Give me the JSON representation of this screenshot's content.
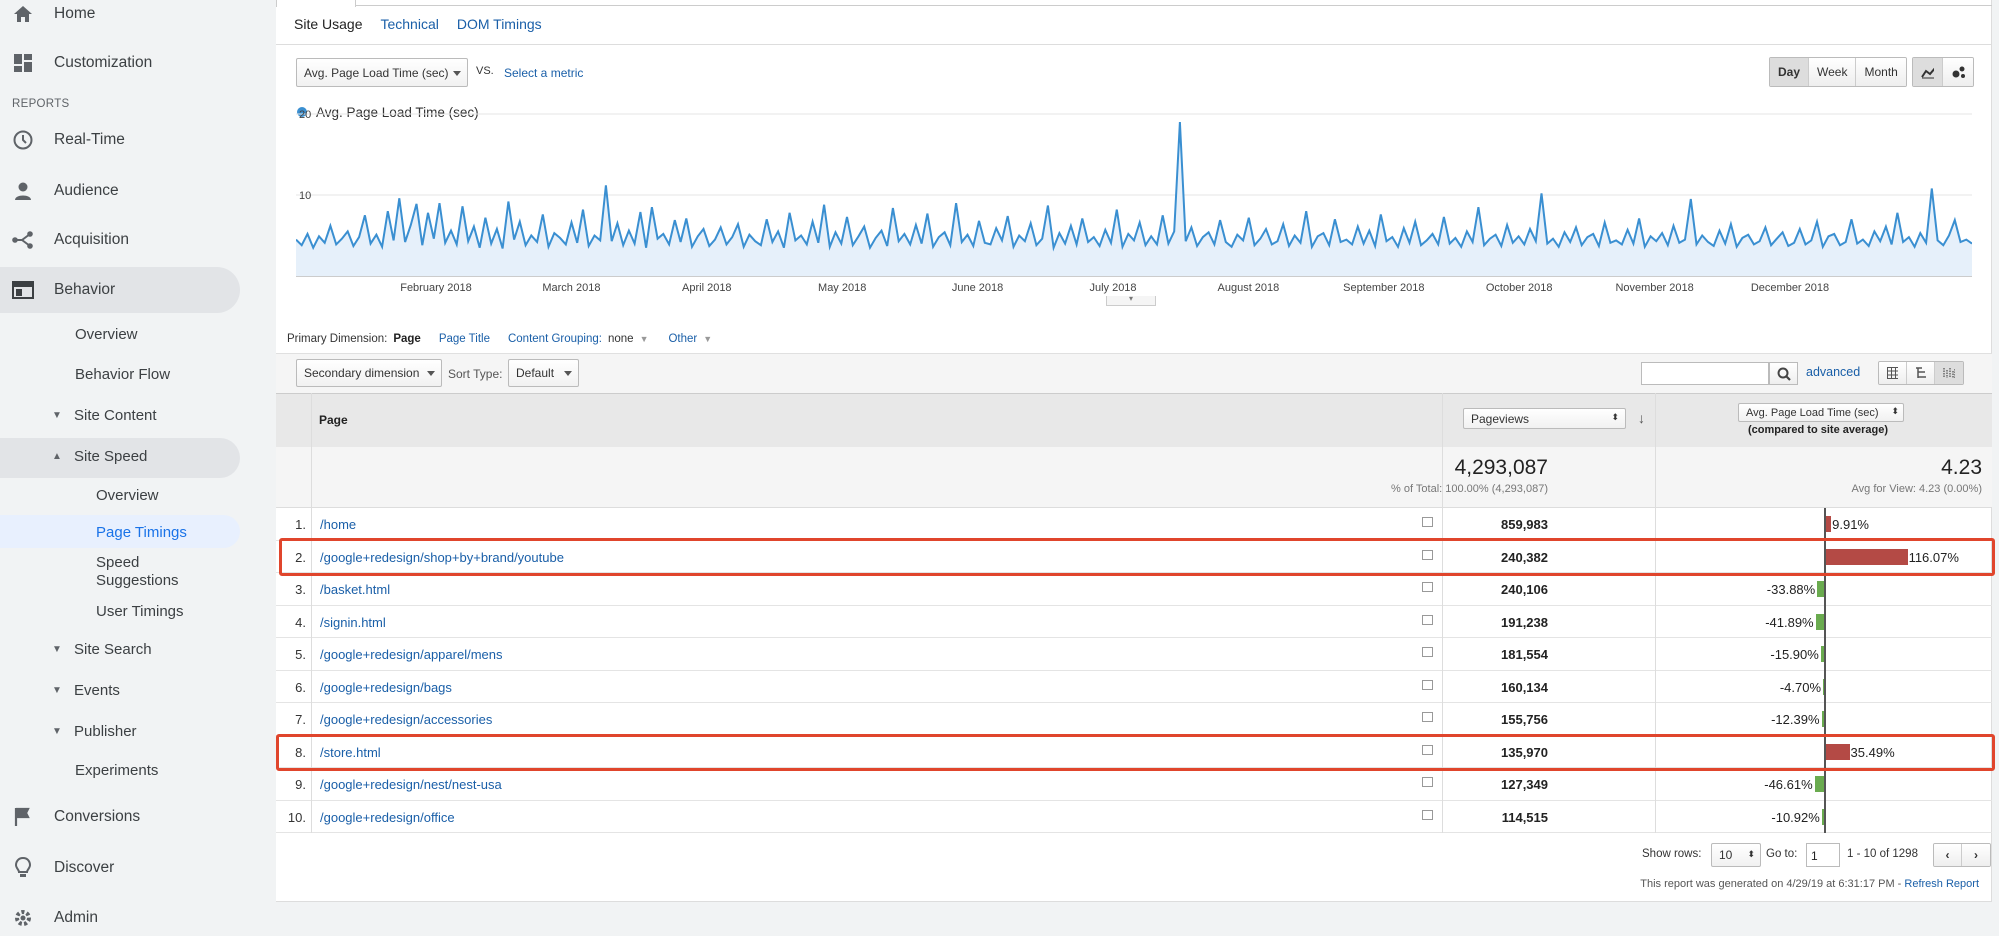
{
  "sidebar": {
    "home": "Home",
    "customization": "Customization",
    "reports_label": "REPORTS",
    "realtime": "Real-Time",
    "audience": "Audience",
    "acquisition": "Acquisition",
    "behavior": "Behavior",
    "behavior_sub": {
      "overview": "Overview",
      "behavior_flow": "Behavior Flow",
      "site_content": "Site Content",
      "site_speed": "Site Speed",
      "ss_overview": "Overview",
      "page_timings": "Page Timings",
      "speed_suggestions_1": "Speed",
      "speed_suggestions_2": "Suggestions",
      "user_timings": "User Timings",
      "site_search": "Site Search",
      "events": "Events",
      "publisher": "Publisher",
      "experiments": "Experiments"
    },
    "conversions": "Conversions",
    "discover": "Discover",
    "admin": "Admin"
  },
  "tabs": {
    "site_usage": "Site Usage",
    "technical": "Technical",
    "dom_timings": "DOM Timings"
  },
  "metric": {
    "selected": "Avg. Page Load Time (sec)",
    "vs": "VS.",
    "select_metric": "Select a metric"
  },
  "period": {
    "day": "Day",
    "week": "Week",
    "month": "Month"
  },
  "dimension": {
    "label": "Primary Dimension:",
    "page": "Page",
    "page_title": "Page Title",
    "content_grouping": "Content Grouping:",
    "none": "none",
    "other": "Other",
    "secondary": "Secondary dimension",
    "sort_type": "Sort Type:",
    "default": "Default",
    "advanced": "advanced"
  },
  "table": {
    "col_page": "Page",
    "col_pageviews": "Pageviews",
    "col_metric": "Avg. Page Load Time (sec)",
    "col_metric_sub": "(compared to site average)",
    "total_pageviews": "4,293,087",
    "total_pageviews_sub": "% of Total: 100.00% (4,293,087)",
    "total_metric": "4.23",
    "total_metric_sub": "Avg for View: 4.23 (0.00%)",
    "rows": [
      {
        "n": "1.",
        "page": "/home",
        "pv": "859,983",
        "pct": "9.91%",
        "delta": 9.91
      },
      {
        "n": "2.",
        "page": "/google+redesign/shop+by+brand/youtube",
        "pv": "240,382",
        "pct": "116.07%",
        "delta": 116.07
      },
      {
        "n": "3.",
        "page": "/basket.html",
        "pv": "240,106",
        "pct": "-33.88%",
        "delta": -33.88
      },
      {
        "n": "4.",
        "page": "/signin.html",
        "pv": "191,238",
        "pct": "-41.89%",
        "delta": -41.89
      },
      {
        "n": "5.",
        "page": "/google+redesign/apparel/mens",
        "pv": "181,554",
        "pct": "-15.90%",
        "delta": -15.9
      },
      {
        "n": "6.",
        "page": "/google+redesign/bags",
        "pv": "160,134",
        "pct": "-4.70%",
        "delta": -4.7
      },
      {
        "n": "7.",
        "page": "/google+redesign/accessories",
        "pv": "155,756",
        "pct": "-12.39%",
        "delta": -12.39
      },
      {
        "n": "8.",
        "page": "/store.html",
        "pv": "135,970",
        "pct": "35.49%",
        "delta": 35.49
      },
      {
        "n": "9.",
        "page": "/google+redesign/nest/nest-usa",
        "pv": "127,349",
        "pct": "-46.61%",
        "delta": -46.61
      },
      {
        "n": "10.",
        "page": "/google+redesign/office",
        "pv": "114,515",
        "pct": "-10.92%",
        "delta": -10.92
      }
    ]
  },
  "pagination": {
    "show_rows": "Show rows:",
    "rows_value": "10",
    "goto": "Go to:",
    "goto_value": "1",
    "range": "1 - 10 of 1298",
    "generated": "This report was generated on 4/29/19 at 6:31:17 PM -",
    "refresh": "Refresh Report"
  },
  "colors": {
    "line": "#3a8fd1",
    "positive_bar": "#b44a45",
    "negative_bar": "#6aab4f",
    "highlight_box": "#e0452c"
  },
  "chart_data": {
    "type": "line",
    "legend": "Avg. Page Load Time (sec)",
    "x_tick_labels": [
      "February 2018",
      "March 2018",
      "April 2018",
      "May 2018",
      "June 2018",
      "July 2018",
      "August 2018",
      "September 2018",
      "October 2018",
      "November 2018",
      "December 2018"
    ],
    "y_tick_labels": [
      "10",
      "20"
    ],
    "ylim": [
      0,
      20
    ],
    "series": [
      {
        "values": [
          4.5,
          3.8,
          5.2,
          3.5,
          4.9,
          4.1,
          6.2,
          3.9,
          4.6,
          5.5,
          3.7,
          4.8,
          7.5,
          4.0,
          5.1,
          3.6,
          8.0,
          4.4,
          9.6,
          4.2,
          6.3,
          8.9,
          3.8,
          7.8,
          4.6,
          9.0,
          4.1,
          5.6,
          3.9,
          8.6,
          4.3,
          6.1,
          3.5,
          7.2,
          4.0,
          5.8,
          3.4,
          9.2,
          4.5,
          6.7,
          3.8,
          5.0,
          4.2,
          7.6,
          3.6,
          5.3,
          4.7,
          3.9,
          6.6,
          4.1,
          8.2,
          3.7,
          5.0,
          4.4,
          11.2,
          4.3,
          6.5,
          3.8,
          5.6,
          4.0,
          7.9,
          3.5,
          8.5,
          4.6,
          5.2,
          3.9,
          6.9,
          4.2,
          7.1,
          3.6,
          4.9,
          5.8,
          3.7,
          4.5,
          6.0,
          3.9,
          4.8,
          6.4,
          3.6,
          5.1,
          4.3,
          3.8,
          7.0,
          4.2,
          5.5,
          3.5,
          7.8,
          4.4,
          5.0,
          3.9,
          6.7,
          4.1,
          8.8,
          3.6,
          5.4,
          4.0,
          7.3,
          3.8,
          4.9,
          6.1,
          3.5,
          4.7,
          5.6,
          3.7,
          8.4,
          4.3,
          5.2,
          3.9,
          6.3,
          4.0,
          7.7,
          3.6,
          4.8,
          5.4,
          3.8,
          9.0,
          4.2,
          5.1,
          3.7,
          6.8,
          4.1,
          3.9,
          5.9,
          4.4,
          7.4,
          3.6,
          5.0,
          4.3,
          6.5,
          3.8,
          4.6,
          8.7,
          3.5,
          5.3,
          4.0,
          6.2,
          3.9,
          7.1,
          4.2,
          4.8,
          3.7,
          5.7,
          4.1,
          8.2,
          3.6,
          5.2,
          4.4,
          6.6,
          3.8,
          4.9,
          3.9,
          7.5,
          4.0,
          5.5,
          19.0,
          4.3,
          6.0,
          3.7,
          4.8,
          5.4,
          3.9,
          6.9,
          4.2,
          3.6,
          5.1,
          4.4,
          7.2,
          3.8,
          4.6,
          5.8,
          3.9,
          4.3,
          6.4,
          3.7,
          5.0,
          4.1,
          8.0,
          3.6,
          4.9,
          5.3,
          3.8,
          7.0,
          4.2,
          4.5,
          3.9,
          6.1,
          4.0,
          5.6,
          3.7,
          7.6,
          4.3,
          4.8,
          3.6,
          5.9,
          4.1,
          6.7,
          3.8,
          4.4,
          5.2,
          3.9,
          7.3,
          4.0,
          4.7,
          3.6,
          5.5,
          4.2,
          8.5,
          3.8,
          4.6,
          5.1,
          3.7,
          6.3,
          4.1,
          4.9,
          3.9,
          5.8,
          4.3,
          10.2,
          4.0,
          4.6,
          3.6,
          5.4,
          4.2,
          6.0,
          3.8,
          4.8,
          5.2,
          3.7,
          6.6,
          4.1,
          4.4,
          3.9,
          5.7,
          4.0,
          7.1,
          3.6,
          4.9,
          4.3,
          5.3,
          3.8,
          6.2,
          4.1,
          4.5,
          9.5,
          3.9,
          5.0,
          4.2,
          3.7,
          5.6,
          4.0,
          6.4,
          3.6,
          4.7,
          5.1,
          3.9,
          4.3,
          6.0,
          3.8,
          4.6,
          5.4,
          3.7,
          4.1,
          5.8,
          3.9,
          4.4,
          6.7,
          3.6,
          4.9,
          5.2,
          3.8,
          4.2,
          7.0,
          4.0,
          4.5,
          3.7,
          5.5,
          4.3,
          6.1,
          3.9,
          7.8,
          4.2,
          4.8,
          3.6,
          5.3,
          4.1,
          10.8,
          4.4,
          3.8,
          5.0,
          6.9,
          4.2,
          4.5,
          4.0
        ]
      }
    ]
  }
}
